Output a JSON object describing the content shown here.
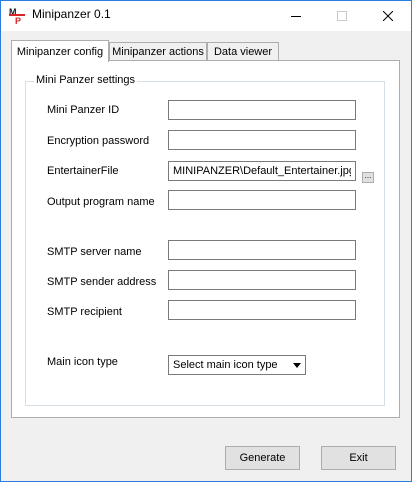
{
  "window": {
    "title": "Minipanzer 0.1",
    "app_icon_letters": "MP"
  },
  "tabs": [
    {
      "label": "Minipanzer config",
      "active": true
    },
    {
      "label": "Minipanzer actions",
      "active": false
    },
    {
      "label": "Data viewer",
      "active": false
    }
  ],
  "settings": {
    "group_title": "Mini Panzer settings",
    "mini_panzer_id": {
      "label": "Mini Panzer ID",
      "value": ""
    },
    "encryption_password": {
      "label": "Encryption password",
      "value": ""
    },
    "entertainer_file": {
      "label": "EntertainerFile",
      "value": "MINIPANZER\\Default_Entertainer.jpg",
      "browse_label": "..."
    },
    "output_program_name": {
      "label": "Output program name",
      "value": ""
    },
    "smtp_server_name": {
      "label": "SMTP server name",
      "value": ""
    },
    "smtp_sender_address": {
      "label": "SMTP sender address",
      "value": ""
    },
    "smtp_recipient": {
      "label": "SMTP recipient",
      "value": ""
    },
    "main_icon_type": {
      "label": "Main icon type",
      "selected": "Select main icon type"
    }
  },
  "buttons": {
    "generate": "Generate",
    "exit": "Exit"
  },
  "colors": {
    "window_border": "#2b7de0",
    "app_icon_red": "#d8232a",
    "app_icon_m": "#1a1a1a"
  }
}
